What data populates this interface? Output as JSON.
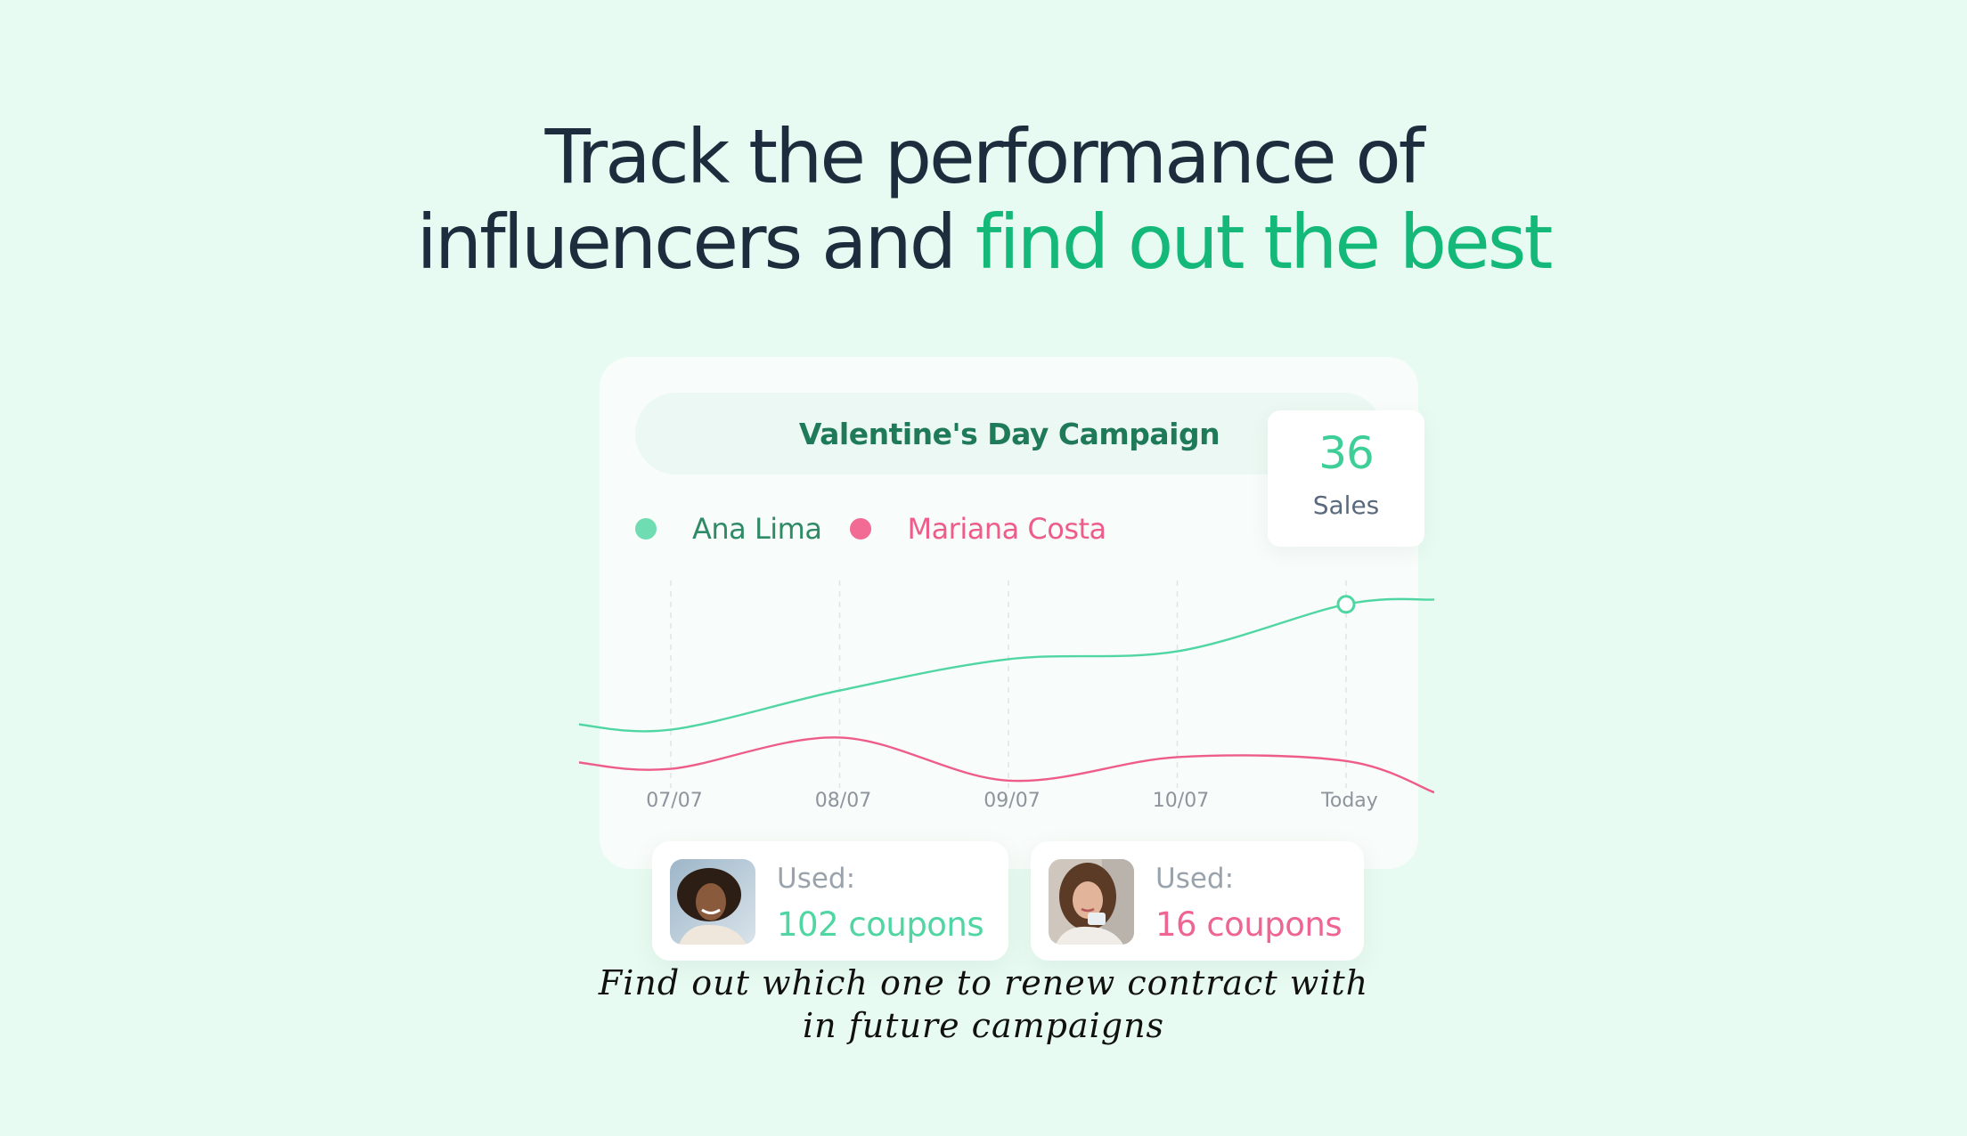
{
  "headline": {
    "line1": "Track the performance of",
    "line2_plain": "influencers and",
    "line2_accent": "find out the best"
  },
  "campaign": {
    "title": "Valentine's Day Campaign"
  },
  "legend": {
    "ana": "Ana Lima",
    "mariana": "Mariana Costa"
  },
  "tooltip": {
    "value": "36",
    "label": "Sales"
  },
  "chart_data": {
    "type": "line",
    "categories": [
      "07/07",
      "08/07",
      "09/07",
      "10/07",
      "Today"
    ],
    "series": [
      {
        "name": "Ana Lima",
        "values": [
          4,
          14,
          22,
          24,
          36
        ]
      },
      {
        "name": "Mariana Costa",
        "values": [
          -6,
          2,
          -9,
          -3,
          -4
        ]
      }
    ],
    "colors": {
      "Ana Lima": "#4fd6a2",
      "Mariana Costa": "#ee5d8a"
    },
    "highlight": {
      "series": "Ana Lima",
      "category": "Today",
      "value": 36
    },
    "grid": "vertical-dashed"
  },
  "coupons": {
    "ana": {
      "used_label": "Used:",
      "count": "102 coupons"
    },
    "mariana": {
      "used_label": "Used:",
      "count": "16 coupons"
    }
  },
  "note": {
    "line1": "Find out which one to renew contract with",
    "line2": "in future campaigns"
  },
  "colors": {
    "background": "#e8fbf2",
    "accent_green": "#14b879",
    "ana_green": "#4fd6a2",
    "mariana_pink": "#ee5d8a",
    "heading": "#1e2d3d"
  }
}
